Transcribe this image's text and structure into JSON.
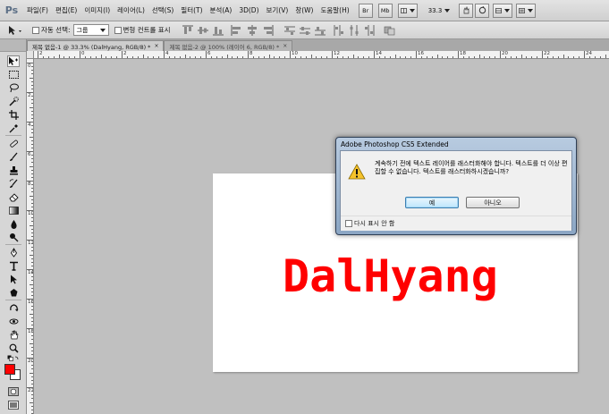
{
  "app": {
    "logo": "Ps"
  },
  "menu": [
    "파일(F)",
    "편집(E)",
    "이미지(I)",
    "레이어(L)",
    "선택(S)",
    "필터(T)",
    "분석(A)",
    "3D(D)",
    "보기(V)",
    "창(W)",
    "도움말(H)"
  ],
  "menubar_tools": {
    "br_label": "Br",
    "mb_label": "Mb",
    "zoom": "33.3"
  },
  "options": {
    "auto_select_label": "자동 선택:",
    "auto_select_value": "그룹",
    "transform_label": "변형 컨트롤 표시"
  },
  "tabs": [
    {
      "label": "제목 없음-1 @ 33.3% (DalHyang, RGB/8) *",
      "close": "×"
    },
    {
      "label": "제목 없음-2 @ 100% (레이어 6, RGB/8) *",
      "close": "×"
    }
  ],
  "ruler_top": [
    "2",
    "0",
    "2",
    "4",
    "6",
    "8",
    "10",
    "12",
    "14",
    "16",
    "18",
    "20",
    "22",
    "24"
  ],
  "ruler_left": [
    "0",
    "2",
    "4",
    "6",
    "8",
    "10",
    "12",
    "14",
    "16",
    "18",
    "20",
    "22"
  ],
  "canvas": {
    "text": "DalHyang",
    "text_color": "#ff0000"
  },
  "colors": {
    "foreground": "#ff0000",
    "background": "#ffffff"
  },
  "dialog": {
    "title": "Adobe Photoshop CS5 Extended",
    "message": "계속하기 전에 텍스트 레이어를 래스터화해야 합니다. 텍스트를 더 이상 편집할 수 없습니다. 텍스트를 래스터화하시겠습니까?",
    "yes_label": "예",
    "no_label": "아니오",
    "dont_show_label": "다시 표시 안 함",
    "icon": "warning-icon"
  }
}
